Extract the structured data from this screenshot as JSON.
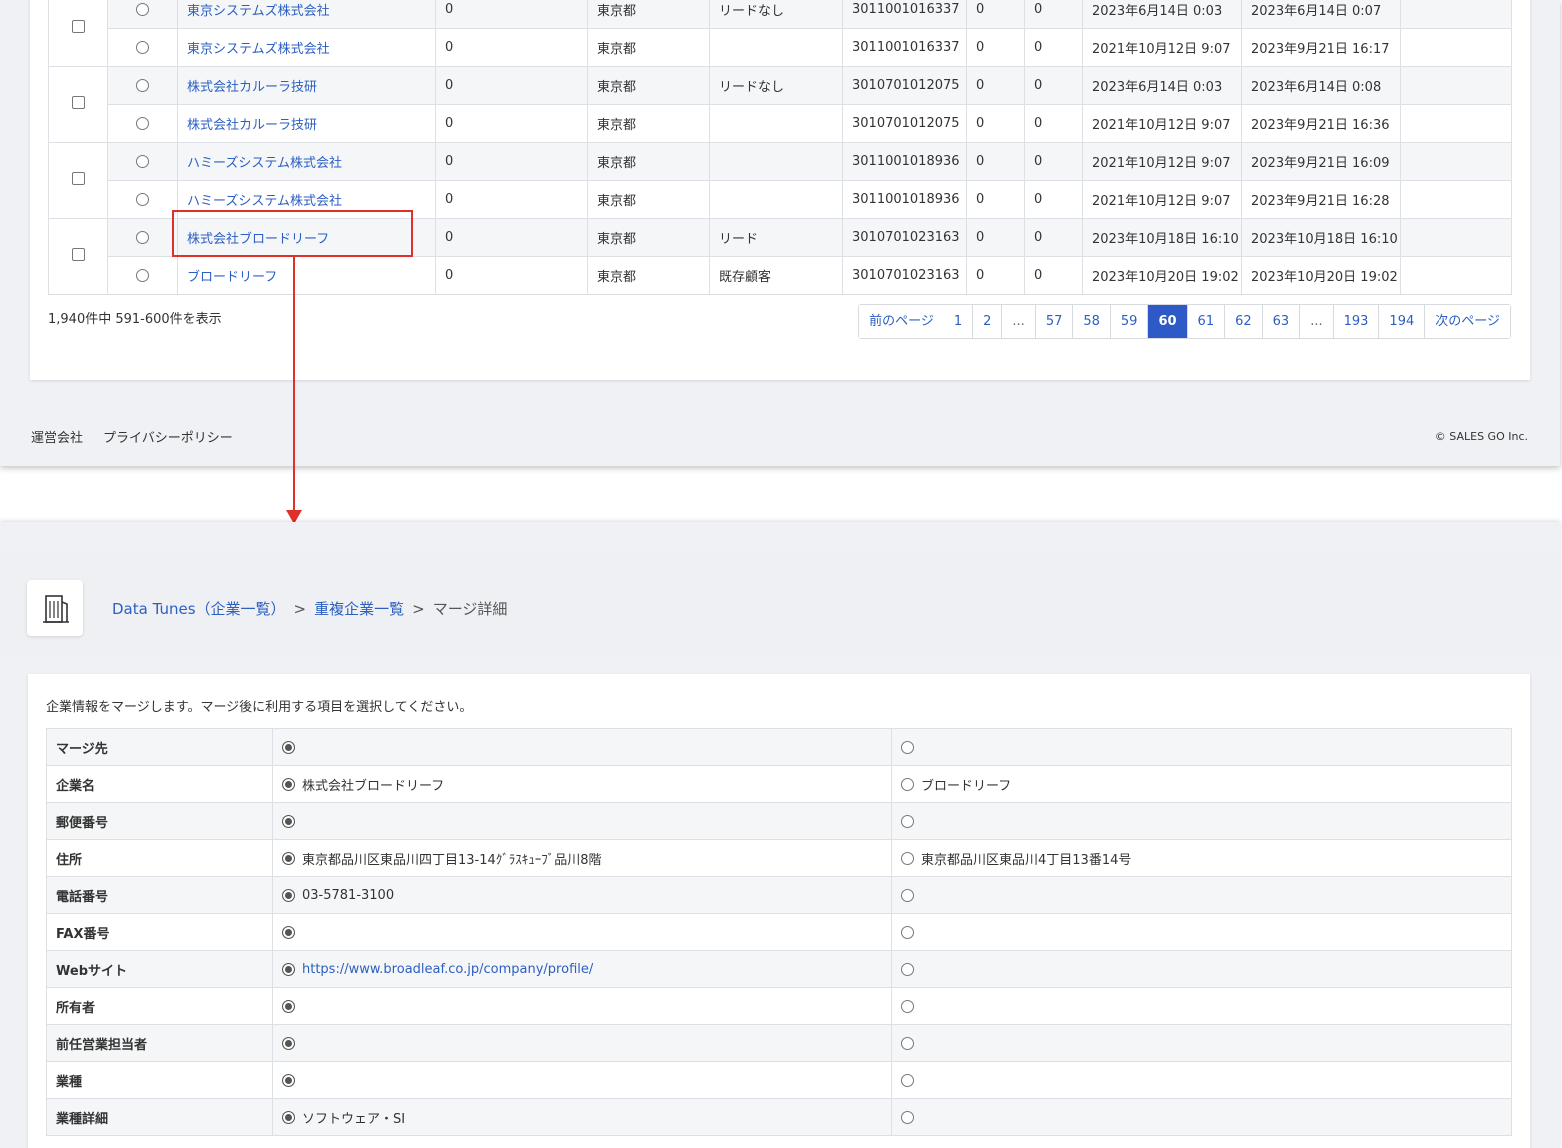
{
  "duplicate_list": {
    "groups": [
      {
        "rows": [
          {
            "company": "東京システムズ株式会社",
            "c1": "0",
            "pref": "東京都",
            "lead": "リードなし",
            "corp_no": "3011001016337",
            "n1": "0",
            "n2": "0",
            "created": "2023年6月14日 0:03",
            "updated": "2023年6月14日 0:07"
          },
          {
            "company": "東京システムズ株式会社",
            "c1": "0",
            "pref": "東京都",
            "lead": "",
            "corp_no": "3011001016337",
            "n1": "0",
            "n2": "0",
            "created": "2021年10月12日 9:07",
            "updated": "2023年9月21日 16:17"
          }
        ]
      },
      {
        "rows": [
          {
            "company": "株式会社カルーラ技研",
            "c1": "0",
            "pref": "東京都",
            "lead": "リードなし",
            "corp_no": "3010701012075",
            "n1": "0",
            "n2": "0",
            "created": "2023年6月14日 0:03",
            "updated": "2023年6月14日 0:08"
          },
          {
            "company": "株式会社カルーラ技研",
            "c1": "0",
            "pref": "東京都",
            "lead": "",
            "corp_no": "3010701012075",
            "n1": "0",
            "n2": "0",
            "created": "2021年10月12日 9:07",
            "updated": "2023年9月21日 16:36"
          }
        ]
      },
      {
        "rows": [
          {
            "company": "ハミーズシステム株式会社",
            "c1": "0",
            "pref": "東京都",
            "lead": "",
            "corp_no": "3011001018936",
            "n1": "0",
            "n2": "0",
            "created": "2021年10月12日 9:07",
            "updated": "2023年9月21日 16:09"
          },
          {
            "company": "ハミーズシステム株式会社",
            "c1": "0",
            "pref": "東京都",
            "lead": "",
            "corp_no": "3011001018936",
            "n1": "0",
            "n2": "0",
            "created": "2021年10月12日 9:07",
            "updated": "2023年9月21日 16:28"
          }
        ]
      },
      {
        "rows": [
          {
            "company": "株式会社ブロードリーフ",
            "c1": "0",
            "pref": "東京都",
            "lead": "リード",
            "corp_no": "3010701023163",
            "n1": "0",
            "n2": "0",
            "created": "2023年10月18日 16:10",
            "updated": "2023年10月18日 16:10"
          },
          {
            "company": "ブロードリーフ",
            "c1": "0",
            "pref": "東京都",
            "lead": "既存顧客",
            "corp_no": "3010701023163",
            "n1": "0",
            "n2": "0",
            "created": "2023年10月20日 19:02",
            "updated": "2023年10月20日 19:02"
          }
        ]
      }
    ],
    "count_text": "1,940件中 591-600件を表示",
    "pagination": {
      "prev": "前のページ",
      "next": "次のページ",
      "pages": [
        "1",
        "2",
        "...",
        "57",
        "58",
        "59",
        "60",
        "61",
        "62",
        "63",
        "...",
        "193",
        "194"
      ],
      "current": "60"
    }
  },
  "footer": {
    "links": [
      "運営会社",
      "プライバシーポリシー"
    ],
    "copyright": "© SALES GO Inc."
  },
  "merge_detail": {
    "breadcrumb": {
      "root": "Data Tunes（企業一覧）",
      "separator": ">",
      "parent": "重複企業一覧",
      "current": "マージ詳細"
    },
    "intro": "企業情報をマージします。マージ後に利用する項目を選択してください。",
    "rows": [
      {
        "label": "マージ先",
        "left": "",
        "right": "",
        "link": false
      },
      {
        "label": "企業名",
        "left": "株式会社ブロードリーフ",
        "right": "ブロードリーフ",
        "link": false
      },
      {
        "label": "郵便番号",
        "left": "",
        "right": "",
        "link": false
      },
      {
        "label": "住所",
        "left": "東京都品川区東品川四丁目13-14ｸﾞﾗｽｷｭｰﾌﾞ品川8階",
        "right": "東京都品川区東品川4丁目13番14号",
        "link": false
      },
      {
        "label": "電話番号",
        "left": "03-5781-3100",
        "right": "",
        "link": false
      },
      {
        "label": "FAX番号",
        "left": "",
        "right": "",
        "link": false
      },
      {
        "label": "Webサイト",
        "left": "https://www.broadleaf.co.jp/company/profile/",
        "right": "",
        "link": true
      },
      {
        "label": "所有者",
        "left": "",
        "right": "",
        "link": false
      },
      {
        "label": "前任営業担当者",
        "left": "",
        "right": "",
        "link": false
      },
      {
        "label": "業種",
        "left": "",
        "right": "",
        "link": false
      },
      {
        "label": "業種詳細",
        "left": "ソフトウェア・SI",
        "right": "",
        "link": false
      }
    ]
  },
  "colors": {
    "accent": "#2e5ac8",
    "link": "#2c5fc2",
    "highlight": "#e0302a"
  }
}
